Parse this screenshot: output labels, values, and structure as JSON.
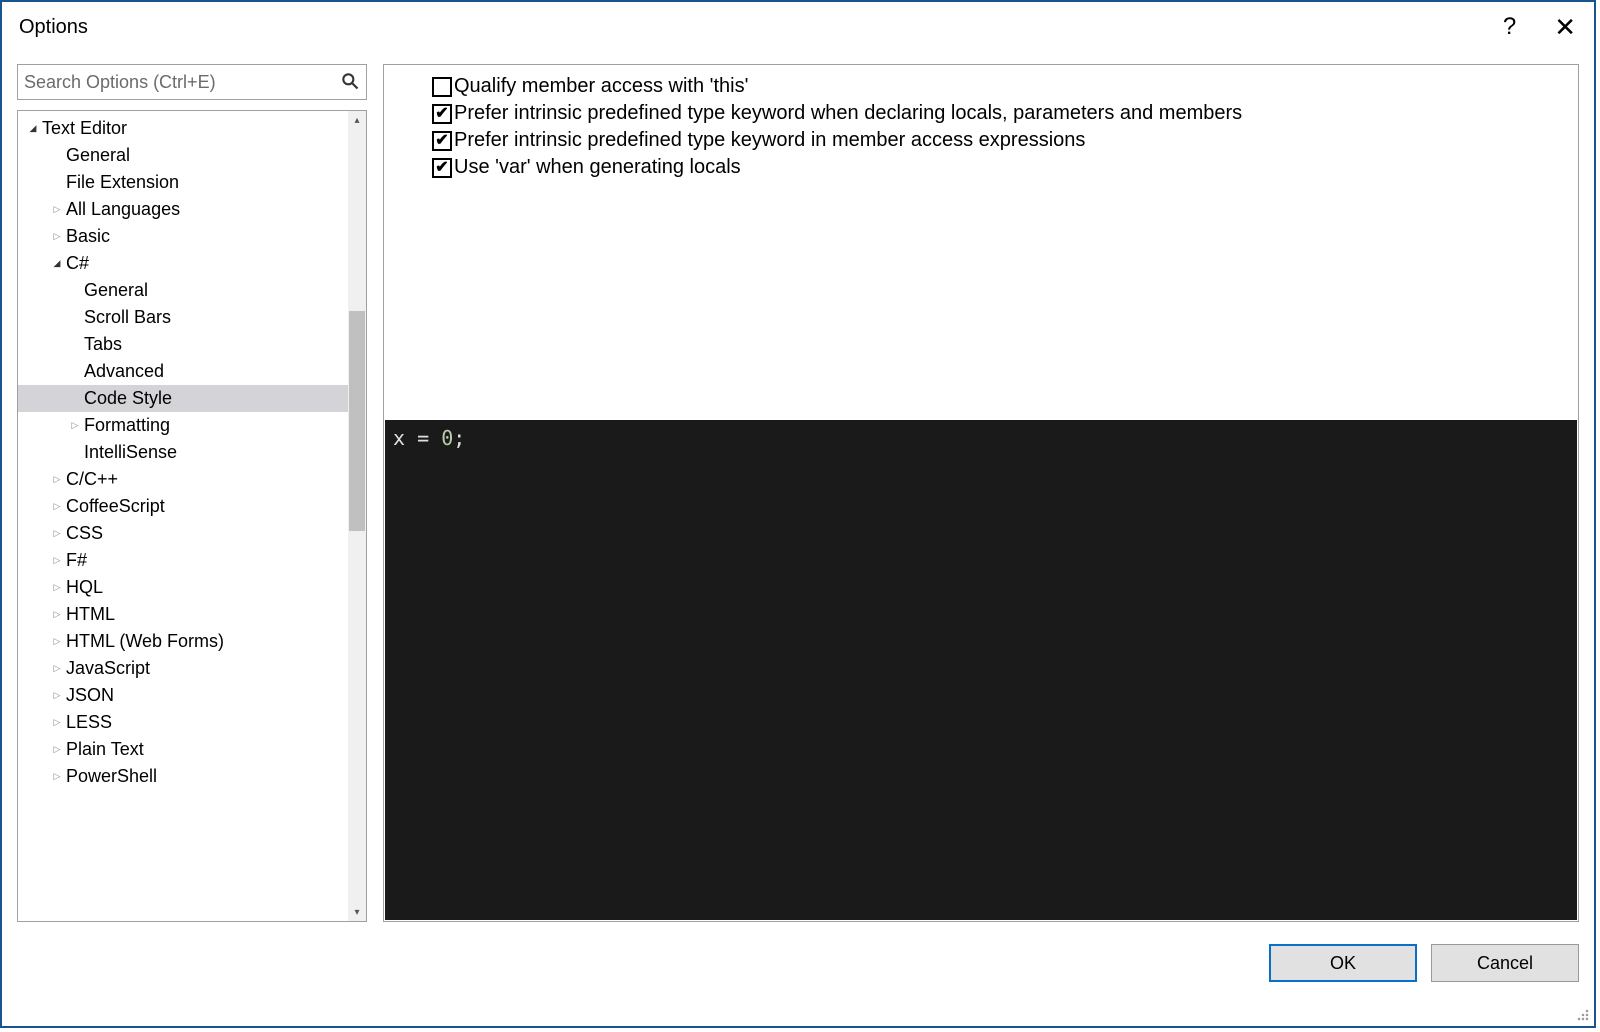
{
  "window": {
    "title": "Options",
    "help_label": "?",
    "close_label": "✕"
  },
  "search": {
    "placeholder": "Search Options (Ctrl+E)"
  },
  "tree": {
    "items": [
      {
        "label": "Text Editor",
        "indent": 0,
        "arrow": "expanded",
        "selected": false
      },
      {
        "label": "General",
        "indent": 1,
        "arrow": "none",
        "selected": false
      },
      {
        "label": "File Extension",
        "indent": 1,
        "arrow": "none",
        "selected": false
      },
      {
        "label": "All Languages",
        "indent": 1,
        "arrow": "collapsed",
        "selected": false
      },
      {
        "label": "Basic",
        "indent": 1,
        "arrow": "collapsed",
        "selected": false
      },
      {
        "label": "C#",
        "indent": 1,
        "arrow": "expanded",
        "selected": false
      },
      {
        "label": "General",
        "indent": 2,
        "arrow": "none",
        "selected": false
      },
      {
        "label": "Scroll Bars",
        "indent": 2,
        "arrow": "none",
        "selected": false
      },
      {
        "label": "Tabs",
        "indent": 2,
        "arrow": "none",
        "selected": false
      },
      {
        "label": "Advanced",
        "indent": 2,
        "arrow": "none",
        "selected": false
      },
      {
        "label": "Code Style",
        "indent": 2,
        "arrow": "none",
        "selected": true
      },
      {
        "label": "Formatting",
        "indent": 2,
        "arrow": "collapsed",
        "selected": false
      },
      {
        "label": "IntelliSense",
        "indent": 2,
        "arrow": "none",
        "selected": false
      },
      {
        "label": "C/C++",
        "indent": 1,
        "arrow": "collapsed",
        "selected": false
      },
      {
        "label": "CoffeeScript",
        "indent": 1,
        "arrow": "collapsed",
        "selected": false
      },
      {
        "label": "CSS",
        "indent": 1,
        "arrow": "collapsed",
        "selected": false
      },
      {
        "label": "F#",
        "indent": 1,
        "arrow": "collapsed",
        "selected": false
      },
      {
        "label": "HQL",
        "indent": 1,
        "arrow": "collapsed",
        "selected": false
      },
      {
        "label": "HTML",
        "indent": 1,
        "arrow": "collapsed",
        "selected": false
      },
      {
        "label": "HTML (Web Forms)",
        "indent": 1,
        "arrow": "collapsed",
        "selected": false
      },
      {
        "label": "JavaScript",
        "indent": 1,
        "arrow": "collapsed",
        "selected": false
      },
      {
        "label": "JSON",
        "indent": 1,
        "arrow": "collapsed",
        "selected": false
      },
      {
        "label": "LESS",
        "indent": 1,
        "arrow": "collapsed",
        "selected": false
      },
      {
        "label": "Plain Text",
        "indent": 1,
        "arrow": "collapsed",
        "selected": false
      },
      {
        "label": "PowerShell",
        "indent": 1,
        "arrow": "collapsed",
        "selected": false
      }
    ]
  },
  "options": {
    "checks": [
      {
        "label": "Qualify member access with 'this'",
        "checked": false
      },
      {
        "label": "Prefer intrinsic predefined type keyword when declaring locals, parameters and members",
        "checked": true
      },
      {
        "label": "Prefer intrinsic predefined type keyword in member access expressions",
        "checked": true
      },
      {
        "label": "Use 'var' when generating locals",
        "checked": true
      }
    ]
  },
  "code_preview": {
    "text": "x = 0;"
  },
  "buttons": {
    "ok": "OK",
    "cancel": "Cancel"
  }
}
